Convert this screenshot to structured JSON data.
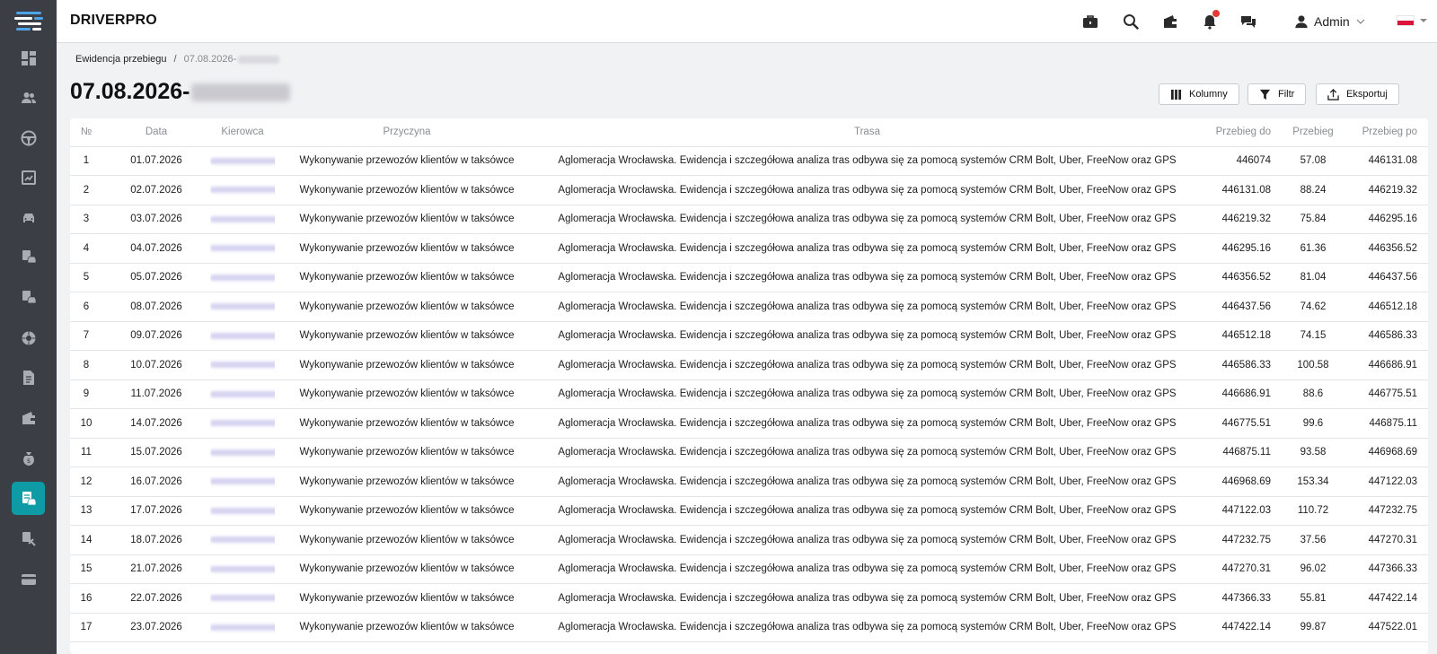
{
  "app": {
    "brand": "DRIVERPRO"
  },
  "sidebar": {
    "items": [
      {
        "name": "dashboard-icon",
        "active": false
      },
      {
        "name": "users-icon",
        "active": false
      },
      {
        "name": "steering-wheel-icon",
        "active": false
      },
      {
        "name": "chart-icon",
        "active": false
      },
      {
        "name": "car-icon",
        "active": false
      },
      {
        "name": "vehicle-report-icon",
        "active": false
      },
      {
        "name": "vehicle-settings-icon",
        "active": false
      },
      {
        "name": "tire-icon",
        "active": false
      },
      {
        "name": "document-icon",
        "active": false
      },
      {
        "name": "wallet-icon",
        "active": false
      },
      {
        "name": "money-bag-icon",
        "active": false
      },
      {
        "name": "mileage-log-icon",
        "active": true
      },
      {
        "name": "tools-icon",
        "active": false
      },
      {
        "name": "card-icon",
        "active": false
      }
    ],
    "active_color": "#0e9ba5"
  },
  "header": {
    "user_label": "Admin",
    "icons": [
      "briefcase-icon",
      "search-icon",
      "wallet-icon",
      "bell-icon",
      "chat-icon",
      "user-icon"
    ]
  },
  "breadcrumb": {
    "parent": "Ewidencja przebiegu",
    "separator": "/",
    "current": "07.08.2026-"
  },
  "page": {
    "title": "07.08.2026-"
  },
  "toolbar": {
    "columns_label": "Kolumny",
    "filter_label": "Filtr",
    "export_label": "Eksportuj"
  },
  "table": {
    "headers": {
      "no": "№",
      "date": "Data",
      "driver": "Kierowca",
      "reason": "Przyczyna",
      "route": "Trasa",
      "mileage_to": "Przebieg do",
      "mileage": "Przebieg",
      "mileage_after": "Przebieg po"
    },
    "rows": [
      {
        "no": "1",
        "date": "01.07.2026",
        "reason": "Wykonywanie przewozów klientów w taksówce",
        "route": "Aglomeracja Wrocławska. Ewidencja i szczegółowa analiza tras odbywa się za pomocą systemów CRM Bolt, Uber, FreeNow oraz GPS",
        "mileage_to": "446074",
        "mileage": "57.08",
        "mileage_after": "446131.08"
      },
      {
        "no": "2",
        "date": "02.07.2026",
        "reason": "Wykonywanie przewozów klientów w taksówce",
        "route": "Aglomeracja Wrocławska. Ewidencja i szczegółowa analiza tras odbywa się za pomocą systemów CRM Bolt, Uber, FreeNow oraz GPS",
        "mileage_to": "446131.08",
        "mileage": "88.24",
        "mileage_after": "446219.32"
      },
      {
        "no": "3",
        "date": "03.07.2026",
        "reason": "Wykonywanie przewozów klientów w taksówce",
        "route": "Aglomeracja Wrocławska. Ewidencja i szczegółowa analiza tras odbywa się za pomocą systemów CRM Bolt, Uber, FreeNow oraz GPS",
        "mileage_to": "446219.32",
        "mileage": "75.84",
        "mileage_after": "446295.16"
      },
      {
        "no": "4",
        "date": "04.07.2026",
        "reason": "Wykonywanie przewozów klientów w taksówce",
        "route": "Aglomeracja Wrocławska. Ewidencja i szczegółowa analiza tras odbywa się za pomocą systemów CRM Bolt, Uber, FreeNow oraz GPS",
        "mileage_to": "446295.16",
        "mileage": "61.36",
        "mileage_after": "446356.52"
      },
      {
        "no": "5",
        "date": "05.07.2026",
        "reason": "Wykonywanie przewozów klientów w taksówce",
        "route": "Aglomeracja Wrocławska. Ewidencja i szczegółowa analiza tras odbywa się za pomocą systemów CRM Bolt, Uber, FreeNow oraz GPS",
        "mileage_to": "446356.52",
        "mileage": "81.04",
        "mileage_after": "446437.56"
      },
      {
        "no": "6",
        "date": "08.07.2026",
        "reason": "Wykonywanie przewozów klientów w taksówce",
        "route": "Aglomeracja Wrocławska. Ewidencja i szczegółowa analiza tras odbywa się za pomocą systemów CRM Bolt, Uber, FreeNow oraz GPS",
        "mileage_to": "446437.56",
        "mileage": "74.62",
        "mileage_after": "446512.18"
      },
      {
        "no": "7",
        "date": "09.07.2026",
        "reason": "Wykonywanie przewozów klientów w taksówce",
        "route": "Aglomeracja Wrocławska. Ewidencja i szczegółowa analiza tras odbywa się za pomocą systemów CRM Bolt, Uber, FreeNow oraz GPS",
        "mileage_to": "446512.18",
        "mileage": "74.15",
        "mileage_after": "446586.33"
      },
      {
        "no": "8",
        "date": "10.07.2026",
        "reason": "Wykonywanie przewozów klientów w taksówce",
        "route": "Aglomeracja Wrocławska. Ewidencja i szczegółowa analiza tras odbywa się za pomocą systemów CRM Bolt, Uber, FreeNow oraz GPS",
        "mileage_to": "446586.33",
        "mileage": "100.58",
        "mileage_after": "446686.91"
      },
      {
        "no": "9",
        "date": "11.07.2026",
        "reason": "Wykonywanie przewozów klientów w taksówce",
        "route": "Aglomeracja Wrocławska. Ewidencja i szczegółowa analiza tras odbywa się za pomocą systemów CRM Bolt, Uber, FreeNow oraz GPS",
        "mileage_to": "446686.91",
        "mileage": "88.6",
        "mileage_after": "446775.51"
      },
      {
        "no": "10",
        "date": "14.07.2026",
        "reason": "Wykonywanie przewozów klientów w taksówce",
        "route": "Aglomeracja Wrocławska. Ewidencja i szczegółowa analiza tras odbywa się za pomocą systemów CRM Bolt, Uber, FreeNow oraz GPS",
        "mileage_to": "446775.51",
        "mileage": "99.6",
        "mileage_after": "446875.11"
      },
      {
        "no": "11",
        "date": "15.07.2026",
        "reason": "Wykonywanie przewozów klientów w taksówce",
        "route": "Aglomeracja Wrocławska. Ewidencja i szczegółowa analiza tras odbywa się za pomocą systemów CRM Bolt, Uber, FreeNow oraz GPS",
        "mileage_to": "446875.11",
        "mileage": "93.58",
        "mileage_after": "446968.69"
      },
      {
        "no": "12",
        "date": "16.07.2026",
        "reason": "Wykonywanie przewozów klientów w taksówce",
        "route": "Aglomeracja Wrocławska. Ewidencja i szczegółowa analiza tras odbywa się za pomocą systemów CRM Bolt, Uber, FreeNow oraz GPS",
        "mileage_to": "446968.69",
        "mileage": "153.34",
        "mileage_after": "447122.03"
      },
      {
        "no": "13",
        "date": "17.07.2026",
        "reason": "Wykonywanie przewozów klientów w taksówce",
        "route": "Aglomeracja Wrocławska. Ewidencja i szczegółowa analiza tras odbywa się za pomocą systemów CRM Bolt, Uber, FreeNow oraz GPS",
        "mileage_to": "447122.03",
        "mileage": "110.72",
        "mileage_after": "447232.75"
      },
      {
        "no": "14",
        "date": "18.07.2026",
        "reason": "Wykonywanie przewozów klientów w taksówce",
        "route": "Aglomeracja Wrocławska. Ewidencja i szczegółowa analiza tras odbywa się za pomocą systemów CRM Bolt, Uber, FreeNow oraz GPS",
        "mileage_to": "447232.75",
        "mileage": "37.56",
        "mileage_after": "447270.31"
      },
      {
        "no": "15",
        "date": "21.07.2026",
        "reason": "Wykonywanie przewozów klientów w taksówce",
        "route": "Aglomeracja Wrocławska. Ewidencja i szczegółowa analiza tras odbywa się za pomocą systemów CRM Bolt, Uber, FreeNow oraz GPS",
        "mileage_to": "447270.31",
        "mileage": "96.02",
        "mileage_after": "447366.33"
      },
      {
        "no": "16",
        "date": "22.07.2026",
        "reason": "Wykonywanie przewozów klientów w taksówce",
        "route": "Aglomeracja Wrocławska. Ewidencja i szczegółowa analiza tras odbywa się za pomocą systemów CRM Bolt, Uber, FreeNow oraz GPS",
        "mileage_to": "447366.33",
        "mileage": "55.81",
        "mileage_after": "447422.14"
      },
      {
        "no": "17",
        "date": "23.07.2026",
        "reason": "Wykonywanie przewozów klientów w taksówce",
        "route": "Aglomeracja Wrocławska. Ewidencja i szczegółowa analiza tras odbywa się za pomocą systemów CRM Bolt, Uber, FreeNow oraz GPS",
        "mileage_to": "447422.14",
        "mileage": "99.87",
        "mileage_after": "447522.01"
      }
    ]
  }
}
